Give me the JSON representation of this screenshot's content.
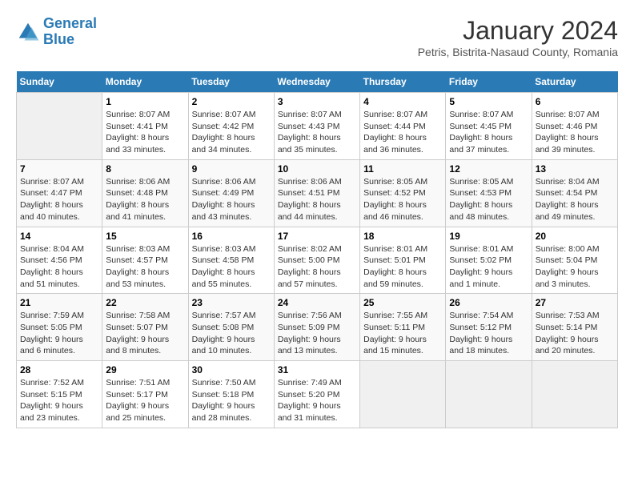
{
  "header": {
    "logo_line1": "General",
    "logo_line2": "Blue",
    "title": "January 2024",
    "subtitle": "Petris, Bistrita-Nasaud County, Romania"
  },
  "days_of_week": [
    "Sunday",
    "Monday",
    "Tuesday",
    "Wednesday",
    "Thursday",
    "Friday",
    "Saturday"
  ],
  "weeks": [
    [
      {
        "day": "",
        "info": ""
      },
      {
        "day": "1",
        "info": "Sunrise: 8:07 AM\nSunset: 4:41 PM\nDaylight: 8 hours\nand 33 minutes."
      },
      {
        "day": "2",
        "info": "Sunrise: 8:07 AM\nSunset: 4:42 PM\nDaylight: 8 hours\nand 34 minutes."
      },
      {
        "day": "3",
        "info": "Sunrise: 8:07 AM\nSunset: 4:43 PM\nDaylight: 8 hours\nand 35 minutes."
      },
      {
        "day": "4",
        "info": "Sunrise: 8:07 AM\nSunset: 4:44 PM\nDaylight: 8 hours\nand 36 minutes."
      },
      {
        "day": "5",
        "info": "Sunrise: 8:07 AM\nSunset: 4:45 PM\nDaylight: 8 hours\nand 37 minutes."
      },
      {
        "day": "6",
        "info": "Sunrise: 8:07 AM\nSunset: 4:46 PM\nDaylight: 8 hours\nand 39 minutes."
      }
    ],
    [
      {
        "day": "7",
        "info": "Sunrise: 8:07 AM\nSunset: 4:47 PM\nDaylight: 8 hours\nand 40 minutes."
      },
      {
        "day": "8",
        "info": "Sunrise: 8:06 AM\nSunset: 4:48 PM\nDaylight: 8 hours\nand 41 minutes."
      },
      {
        "day": "9",
        "info": "Sunrise: 8:06 AM\nSunset: 4:49 PM\nDaylight: 8 hours\nand 43 minutes."
      },
      {
        "day": "10",
        "info": "Sunrise: 8:06 AM\nSunset: 4:51 PM\nDaylight: 8 hours\nand 44 minutes."
      },
      {
        "day": "11",
        "info": "Sunrise: 8:05 AM\nSunset: 4:52 PM\nDaylight: 8 hours\nand 46 minutes."
      },
      {
        "day": "12",
        "info": "Sunrise: 8:05 AM\nSunset: 4:53 PM\nDaylight: 8 hours\nand 48 minutes."
      },
      {
        "day": "13",
        "info": "Sunrise: 8:04 AM\nSunset: 4:54 PM\nDaylight: 8 hours\nand 49 minutes."
      }
    ],
    [
      {
        "day": "14",
        "info": "Sunrise: 8:04 AM\nSunset: 4:56 PM\nDaylight: 8 hours\nand 51 minutes."
      },
      {
        "day": "15",
        "info": "Sunrise: 8:03 AM\nSunset: 4:57 PM\nDaylight: 8 hours\nand 53 minutes."
      },
      {
        "day": "16",
        "info": "Sunrise: 8:03 AM\nSunset: 4:58 PM\nDaylight: 8 hours\nand 55 minutes."
      },
      {
        "day": "17",
        "info": "Sunrise: 8:02 AM\nSunset: 5:00 PM\nDaylight: 8 hours\nand 57 minutes."
      },
      {
        "day": "18",
        "info": "Sunrise: 8:01 AM\nSunset: 5:01 PM\nDaylight: 8 hours\nand 59 minutes."
      },
      {
        "day": "19",
        "info": "Sunrise: 8:01 AM\nSunset: 5:02 PM\nDaylight: 9 hours\nand 1 minute."
      },
      {
        "day": "20",
        "info": "Sunrise: 8:00 AM\nSunset: 5:04 PM\nDaylight: 9 hours\nand 3 minutes."
      }
    ],
    [
      {
        "day": "21",
        "info": "Sunrise: 7:59 AM\nSunset: 5:05 PM\nDaylight: 9 hours\nand 6 minutes."
      },
      {
        "day": "22",
        "info": "Sunrise: 7:58 AM\nSunset: 5:07 PM\nDaylight: 9 hours\nand 8 minutes."
      },
      {
        "day": "23",
        "info": "Sunrise: 7:57 AM\nSunset: 5:08 PM\nDaylight: 9 hours\nand 10 minutes."
      },
      {
        "day": "24",
        "info": "Sunrise: 7:56 AM\nSunset: 5:09 PM\nDaylight: 9 hours\nand 13 minutes."
      },
      {
        "day": "25",
        "info": "Sunrise: 7:55 AM\nSunset: 5:11 PM\nDaylight: 9 hours\nand 15 minutes."
      },
      {
        "day": "26",
        "info": "Sunrise: 7:54 AM\nSunset: 5:12 PM\nDaylight: 9 hours\nand 18 minutes."
      },
      {
        "day": "27",
        "info": "Sunrise: 7:53 AM\nSunset: 5:14 PM\nDaylight: 9 hours\nand 20 minutes."
      }
    ],
    [
      {
        "day": "28",
        "info": "Sunrise: 7:52 AM\nSunset: 5:15 PM\nDaylight: 9 hours\nand 23 minutes."
      },
      {
        "day": "29",
        "info": "Sunrise: 7:51 AM\nSunset: 5:17 PM\nDaylight: 9 hours\nand 25 minutes."
      },
      {
        "day": "30",
        "info": "Sunrise: 7:50 AM\nSunset: 5:18 PM\nDaylight: 9 hours\nand 28 minutes."
      },
      {
        "day": "31",
        "info": "Sunrise: 7:49 AM\nSunset: 5:20 PM\nDaylight: 9 hours\nand 31 minutes."
      },
      {
        "day": "",
        "info": ""
      },
      {
        "day": "",
        "info": ""
      },
      {
        "day": "",
        "info": ""
      }
    ]
  ]
}
